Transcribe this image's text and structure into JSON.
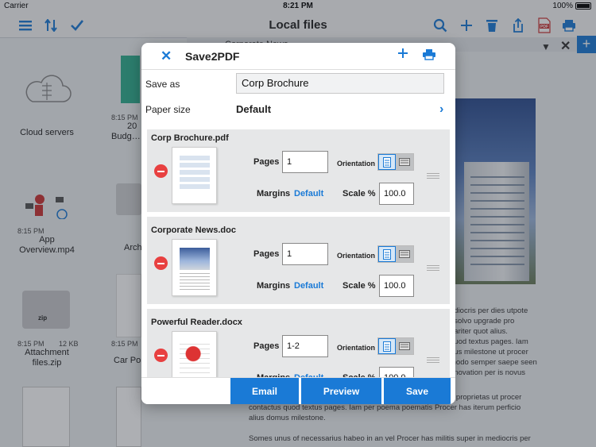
{
  "status_bar": {
    "carrier": "Carrier",
    "time": "8:21 PM",
    "battery": "100%"
  },
  "navbar": {
    "title": "Local files"
  },
  "background": {
    "tiles": [
      {
        "label": "Cloud servers"
      },
      {
        "meta": "8:15 PM",
        "label_1": "App",
        "label_2": "Overview.mp4"
      },
      {
        "meta": "8:15 PM",
        "size": "12 KB",
        "label_1": "Attachment",
        "label_2": "files.zip",
        "zip": "zip"
      }
    ],
    "partial": {
      "meta1": "8:15 PM",
      "l1": "20",
      "l2": "Budg…",
      "l3": "Arch",
      "meta2": "8:15 PM",
      "l4": "Car Po"
    },
    "tab_title": "Corporate News",
    "body_lines": [
      "ediocris per dies utpote",
      "t solvo upgrade pro",
      "pariter quot alius.",
      "quod textus pages. Iam",
      "nus milestone ut procer",
      "modo semper saepe seen",
      "nnovation per is novus",
      "a proprietas ut procer",
      "contactus quod textus pages. Iam per poema poematis Procer has iterum perficio",
      "alius domus milestone.",
      "Somes unus of necessarius habeo in an vel Procer has militis super in mediocris per"
    ]
  },
  "modal": {
    "title": "Save2PDF",
    "save_as_label": "Save as",
    "save_as_value": "Corp Brochure",
    "paper_size_label": "Paper size",
    "paper_size_value": "Default",
    "files": [
      {
        "name": "Corp Brochure.pdf",
        "pages": "1",
        "scale": "100.0"
      },
      {
        "name": "Corporate News.doc",
        "pages": "1",
        "scale": "100.0"
      },
      {
        "name": "Powerful Reader.docx",
        "pages": "1-2",
        "scale": "100.0"
      }
    ],
    "labels": {
      "pages": "Pages",
      "orientation": "Orientation",
      "margins": "Margins",
      "margins_value": "Default",
      "scale": "Scale %"
    },
    "buttons": {
      "email": "Email",
      "preview": "Preview",
      "save": "Save"
    }
  },
  "colors": {
    "accent": "#1a7ad6",
    "delete": "#e84040"
  }
}
